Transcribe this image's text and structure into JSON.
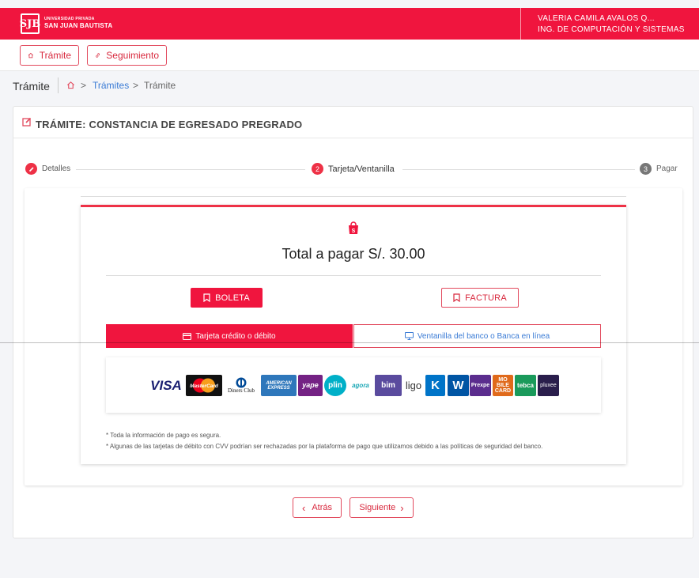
{
  "header": {
    "logo_initials": "SJB",
    "logo_small": "UNIVERSIDAD PRIVADA",
    "logo_big": "SAN JUAN BAUTISTA",
    "user_name": "VALERIA CAMILA AVALOS Q...",
    "user_program": "ING. DE COMPUTACIÓN Y SISTEMAS"
  },
  "nav": {
    "tramite": "Trámite",
    "seguimiento": "Seguimiento"
  },
  "breadcrumb": {
    "title": "Trámite",
    "link": "Trámites",
    "current": "Trámite",
    "chevron": ">"
  },
  "card": {
    "title": "TRÁMITE: CONSTANCIA DE EGRESADO PREGRADO"
  },
  "stepper": {
    "steps": [
      {
        "number": "",
        "label": "Detalles"
      },
      {
        "number": "2",
        "label": "Tarjeta/Ventanilla"
      },
      {
        "number": "3",
        "label": "Pagar"
      }
    ]
  },
  "payment": {
    "total": "Total a pagar S/. 30.00",
    "boleta": "BOLETA",
    "factura": "FACTURA",
    "tab_card": "Tarjeta crédito o débito",
    "tab_bank": "Ventanilla del banco o Banca en línea",
    "brands": [
      {
        "name": "VISA",
        "color": "#1a1f71"
      },
      {
        "name": "MasterCard",
        "color": "#000000"
      },
      {
        "name": "Diners Club",
        "color": "#004a97"
      },
      {
        "name": "AMERICAN EXPRESS",
        "color": "#2e77bb"
      },
      {
        "name": "yape",
        "color": "#742284"
      },
      {
        "name": "plin",
        "color": "#00b0c8"
      },
      {
        "name": "agora",
        "color": "#1aa7b5"
      },
      {
        "name": "bim",
        "color": "#5a4b9e"
      },
      {
        "name": "ligo",
        "color": "#333333"
      },
      {
        "name": "K",
        "color": "#0074c8"
      },
      {
        "name": "W",
        "color": "#0055a4"
      },
      {
        "name": "Prexpe",
        "color": "#5b2d8e"
      },
      {
        "name": "MO BILE CARD",
        "color": "#e06a1b"
      },
      {
        "name": "tebca",
        "color": "#1a9a5b"
      },
      {
        "name": "pluxee",
        "color": "#2a1e4c"
      }
    ],
    "note1": "* Toda la información de pago es segura.",
    "note2": "* Algunas de las tarjetas de débito con CVV podrían ser rechazadas por la plataforma de pago que utilizamos debido a las políticas de seguridad del banco."
  },
  "actions": {
    "back": "Atrás",
    "next": "Siguiente",
    "back_chevron": "‹",
    "next_chevron": "›"
  },
  "colors": {
    "brand_red": "#f0153e",
    "link_blue": "#3a7bd5"
  }
}
